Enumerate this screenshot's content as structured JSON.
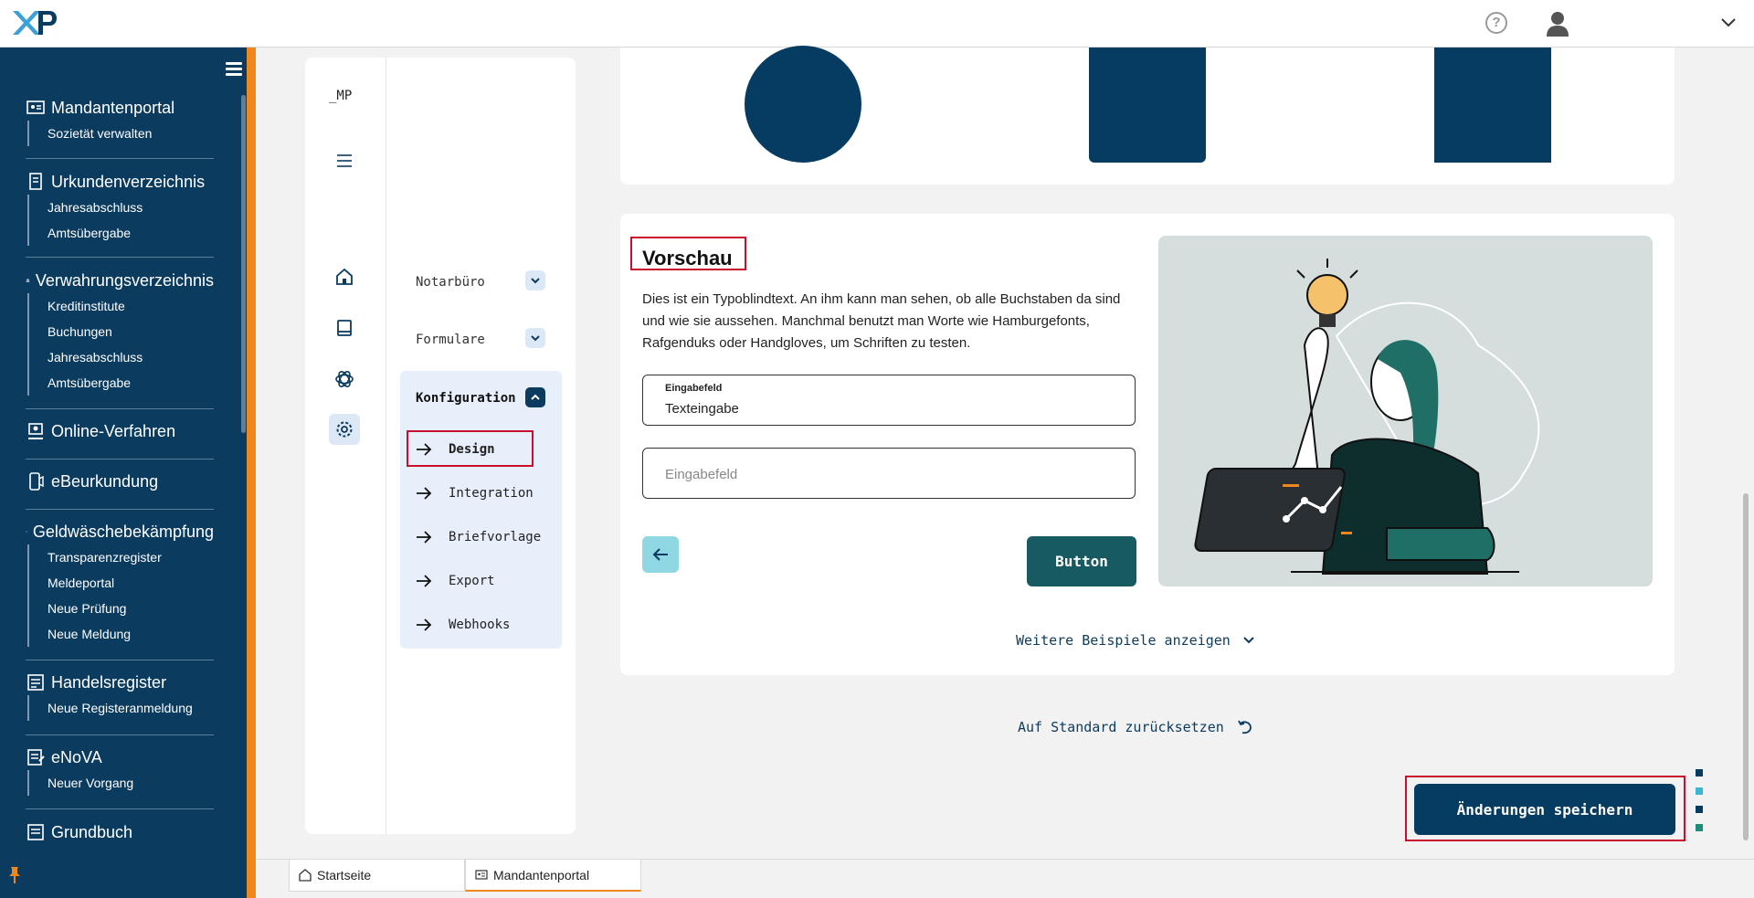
{
  "app": {
    "logo_text": "XP"
  },
  "topbar": {
    "help_icon": "question-circle-icon",
    "user_icon": "user-icon",
    "menu_icon": "chevron-down-icon"
  },
  "sidebar": {
    "groups": [
      {
        "title": "Mandantenportal",
        "icon": "portal-icon",
        "items": [
          "Sozietät verwalten"
        ]
      },
      {
        "title": "Urkundenverzeichnis",
        "icon": "document-icon",
        "items": [
          "Jahresabschluss",
          "Amtsübergabe"
        ]
      },
      {
        "title": "Verwahrungsverzeichnis",
        "icon": "bank-icon",
        "items": [
          "Kreditinstitute",
          "Buchungen",
          "Jahresabschluss",
          "Amtsübergabe"
        ]
      },
      {
        "title": "Online-Verfahren",
        "icon": "online-icon",
        "items": []
      },
      {
        "title": "eBeurkundung",
        "icon": "ebeurkundung-icon",
        "items": []
      },
      {
        "title": "Geldwäschebekämpfung",
        "icon": "euro-icon",
        "items": [
          "Transparenzregister",
          "Meldeportal",
          "Neue Prüfung",
          "Neue Meldung"
        ]
      },
      {
        "title": "Handelsregister",
        "icon": "register-icon",
        "items": [
          "Neue Registeranmeldung"
        ]
      },
      {
        "title": "eNoVA",
        "icon": "enova-icon",
        "items": [
          "Neuer Vorgang"
        ]
      },
      {
        "title": "Grundbuch",
        "icon": "grundbuch-icon",
        "items": []
      }
    ]
  },
  "nav": {
    "brand": "_MP",
    "sections": {
      "notarbuero": "Notarbüro",
      "formulare": "Formulare",
      "konfiguration": "Konfiguration"
    },
    "sub_items": [
      "Design",
      "Integration",
      "Briefvorlage",
      "Export",
      "Webhooks"
    ]
  },
  "preview": {
    "title": "Vorschau",
    "text": "Dies ist ein Typoblindtext. An ihm kann man sehen, ob alle Buchstaben da sind und wie sie aussehen. Manchmal benutzt man Worte wie Hamburgefonts, Rafgenduks oder Handgloves, um Schriften zu testen.",
    "field1_label": "Eingabefeld",
    "field1_value": "Texteingabe",
    "field2_placeholder": "Eingabefeld",
    "button_label": "Button",
    "more_link": "Weitere Beispiele anzeigen"
  },
  "actions": {
    "reset": "Auf Standard zurücksetzen",
    "save": "Änderungen speichern"
  },
  "tabs": [
    "Startseite",
    "Mandantenportal"
  ],
  "colors": {
    "primary": "#063b62",
    "accent": "#f0861e",
    "teal": "#175a61",
    "light_cyan": "#8fd7e3",
    "highlight": "#c8102e"
  }
}
